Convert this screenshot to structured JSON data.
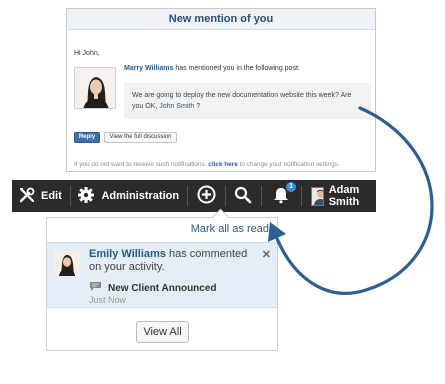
{
  "email": {
    "title": "New mention of you",
    "greeting": "Hi John,",
    "sender_name": "Marry Williams",
    "mention_text": "has mentioned you in the following post:",
    "quote_text": "We are going to deploy the new documentation website this week? Are you OK,",
    "quote_mention": "John Smith",
    "quote_end": "?",
    "reply_label": "Reply",
    "view_discussion_label": "View the full discussion",
    "footer_prefix": "If you do not want to receive such notifications,",
    "footer_link": "click here",
    "footer_suffix": "to change your notification settings."
  },
  "toolbar": {
    "edit_label": "Edit",
    "admin_label": "Administration",
    "notification_count": "1",
    "user_name": "Adam Smith",
    "background_color": "#2b2b2b",
    "badge_color": "#3a8bd9"
  },
  "notifications": {
    "mark_all_label": "Mark all as read",
    "items": [
      {
        "user": "Emily Williams",
        "text": "has commented on your activity.",
        "post_title": "New Client Announced",
        "time": "Just Now"
      }
    ],
    "view_all_label": "View All"
  },
  "colors": {
    "link": "#2a5a8c",
    "highlight_row": "#e4ecf5",
    "arrow": "#2d5f94"
  }
}
